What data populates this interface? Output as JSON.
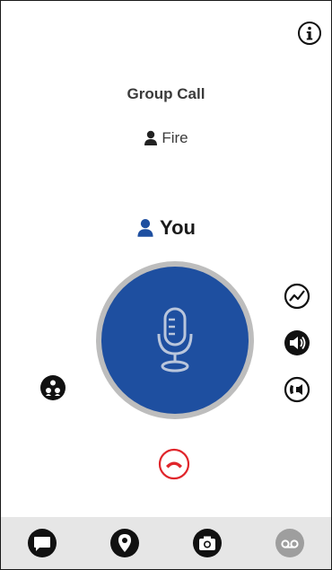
{
  "call": {
    "type_label": "Group Call",
    "group_name": "Fire",
    "talker_label": "You"
  },
  "icons": {
    "info": "info-icon",
    "talker": "person-icon",
    "group": "person-icon",
    "mic": "microphone-icon",
    "activity": "activity-icon",
    "speaker": "speaker-icon",
    "call_mode": "call-mode-icon",
    "members": "members-icon",
    "end_call": "end-call-icon",
    "nav": [
      "message-icon",
      "location-pin-icon",
      "camera-icon",
      "voicemail-icon"
    ]
  },
  "colors": {
    "ptt_blue": "#1e4fa0",
    "talker_blue": "#1e4fa0",
    "end_call_red": "#e0252b",
    "disabled_gray": "#9e9e9e"
  }
}
